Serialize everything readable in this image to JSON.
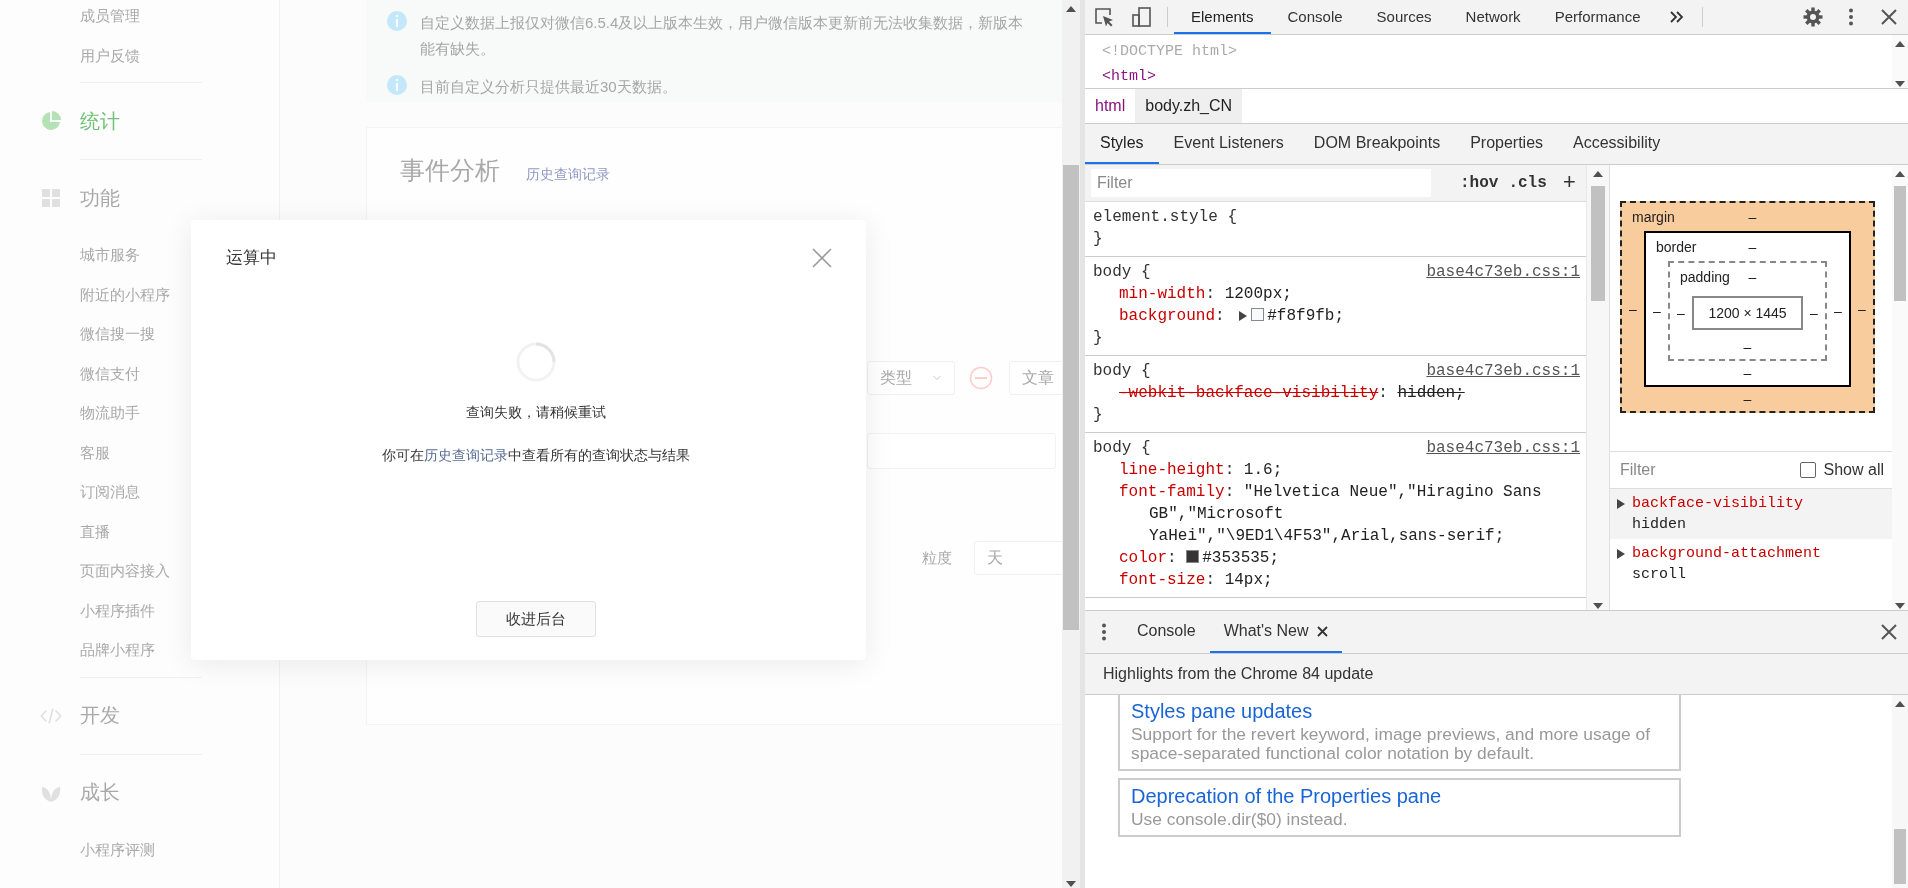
{
  "sidebar": {
    "items": [
      {
        "kind": "sub",
        "label": "成员管理",
        "selected": false
      },
      {
        "kind": "sub",
        "label": "用户反馈",
        "selected": false
      },
      {
        "kind": "section",
        "label": "统计",
        "selected": true
      },
      {
        "kind": "section",
        "label": "功能",
        "selected": false
      },
      {
        "kind": "sub",
        "label": "城市服务",
        "selected": false
      },
      {
        "kind": "sub",
        "label": "附近的小程序",
        "selected": false
      },
      {
        "kind": "sub",
        "label": "微信搜一搜",
        "selected": false
      },
      {
        "kind": "sub",
        "label": "微信支付",
        "selected": false
      },
      {
        "kind": "sub",
        "label": "物流助手",
        "selected": false
      },
      {
        "kind": "sub",
        "label": "客服",
        "selected": false
      },
      {
        "kind": "sub",
        "label": "订阅消息",
        "selected": false
      },
      {
        "kind": "sub",
        "label": "直播",
        "selected": false
      },
      {
        "kind": "sub",
        "label": "页面内容接入",
        "selected": false
      },
      {
        "kind": "sub",
        "label": "小程序插件",
        "selected": false
      },
      {
        "kind": "sub",
        "label": "品牌小程序",
        "selected": false
      },
      {
        "kind": "section",
        "label": "开发",
        "selected": false
      },
      {
        "kind": "section",
        "label": "成长",
        "selected": false
      },
      {
        "kind": "sub",
        "label": "小程序评测",
        "selected": false
      }
    ]
  },
  "notices": [
    {
      "lines": [
        "自定义数据上报仅对微信6.5.4及以上版本生效，用户微信版本更新前无法收集数据，新版本",
        "能有缺失。"
      ]
    },
    {
      "lines": [
        "目前自定义分析只提供最近30天数据。"
      ]
    }
  ],
  "event_card": {
    "title": "事件分析",
    "history_link": "历史查询记录",
    "field_1": "类型",
    "field_2": "文章",
    "granularity_label": "粒度",
    "granularity_value": "天"
  },
  "dialog": {
    "title": "运算中",
    "message": "查询失败，请稍候重试",
    "hint_before": "你可在",
    "hint_link": "历史查询记录",
    "hint_after": "中查看所有的查询状态与结果",
    "button": "收进后台"
  },
  "devtools": {
    "tabs": [
      {
        "label": "Elements",
        "selected": true
      },
      {
        "label": "Console",
        "selected": false
      },
      {
        "label": "Sources",
        "selected": false
      },
      {
        "label": "Network",
        "selected": false
      },
      {
        "label": "Performance",
        "selected": false
      }
    ],
    "dom_lines": [
      {
        "kind": "doctype",
        "text": "<!DOCTYPE html>"
      },
      {
        "kind": "tag",
        "text": "<html>"
      }
    ],
    "breadcrumbs": [
      {
        "label": "html",
        "selected": false
      },
      {
        "label": "body.zh_CN",
        "selected": true
      }
    ],
    "pane_tabs": [
      {
        "label": "Styles",
        "selected": true
      },
      {
        "label": "Event Listeners",
        "selected": false
      },
      {
        "label": "DOM Breakpoints",
        "selected": false
      },
      {
        "label": "Properties",
        "selected": false
      },
      {
        "label": "Accessibility",
        "selected": false
      }
    ],
    "styles_filter": {
      "placeholder": "Filter"
    },
    "hov": ":hov",
    "cls": ".cls",
    "add": "+",
    "rules": [
      {
        "selector": "element.style",
        "open": "{",
        "close": "}"
      },
      {
        "selector": "body",
        "open": "{",
        "close": "}",
        "source": "base4c73eb.css:1",
        "props": [
          {
            "name": "min-width",
            "sep": ":",
            "value": "1200px;",
            "overridden": false
          },
          {
            "name": "background",
            "sep": ":",
            "value": "#f8f9fb;",
            "overridden": false,
            "expandable": true,
            "swatch": true
          }
        ]
      },
      {
        "selector": "body",
        "open": "{",
        "close": "}",
        "source": "base4c73eb.css:1",
        "props": [
          {
            "name": "-webkit-backface-visibility",
            "sep": ":",
            "value": "hidden;",
            "overridden": true
          }
        ]
      },
      {
        "selector": "body",
        "open": "{",
        "source": "base4c73eb.css:1",
        "props": [
          {
            "name": "line-height",
            "sep": ":",
            "value": "1.6;",
            "overridden": false
          },
          {
            "name": "font-family",
            "sep": ":",
            "value": "\"Helvetica Neue\",\"Hiragino Sans GB\",\"Microsoft YaHei\",\"\\9ED1\\4F53\",Arial,sans-serif;",
            "overridden": false
          },
          {
            "name": "color",
            "sep": ":",
            "value": "#353535;",
            "overridden": false,
            "swatch": true
          },
          {
            "name": "font-size",
            "sep": ":",
            "value": "14px;",
            "overridden": false
          }
        ]
      }
    ],
    "box_model": {
      "margin": {
        "label": "margin",
        "top": "–",
        "right": "–",
        "bottom": "–",
        "left": "–"
      },
      "border": {
        "label": "border",
        "top": "–",
        "right": "–",
        "bottom": "–",
        "left": "–"
      },
      "padding": {
        "label": "padding",
        "top": "–",
        "right": "–",
        "bottom": "–",
        "left": "–"
      },
      "content": "1200 × 1445"
    },
    "computed": {
      "filter": {
        "placeholder": "Filter"
      },
      "show_all": {
        "label": "Show all",
        "checked": false
      },
      "properties": [
        {
          "name": "backface-visibility",
          "value": "hidden"
        },
        {
          "name": "background-attachment",
          "value": "scroll"
        }
      ]
    },
    "drawer": {
      "tabs": [
        {
          "label": "Console",
          "selected": false,
          "closable": false
        },
        {
          "label": "What's New",
          "selected": true,
          "closable": true
        }
      ],
      "header": "Highlights from the Chrome 84 update",
      "cards": [
        {
          "title": "Styles pane updates",
          "description": "Support for the revert keyword, image previews, and more usage of space-separated functional color notation by default."
        },
        {
          "title": "Deprecation of the Properties pane",
          "description": "Use console.dir($0) instead."
        }
      ]
    }
  }
}
